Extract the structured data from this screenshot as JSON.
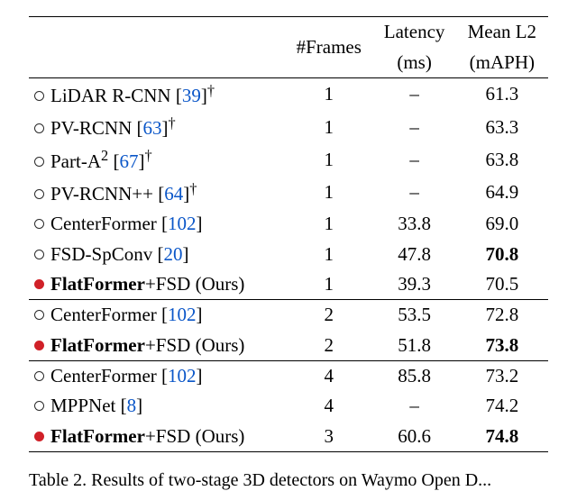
{
  "headers": {
    "method": "",
    "frames": "#Frames",
    "latency_top": "Latency",
    "latency_bot": "(ms)",
    "maph_top": "Mean L2",
    "maph_bot": "(mAPH)"
  },
  "groups": [
    {
      "rows": [
        {
          "bullet": "o",
          "name": "LiDAR R-CNN ",
          "cite": "39",
          "dagger": true,
          "sup": null,
          "bold": false,
          "frames": "1",
          "latency": "–",
          "maph": "61.3",
          "maph_bold": false
        },
        {
          "bullet": "o",
          "name": "PV-RCNN ",
          "cite": "63",
          "dagger": true,
          "sup": null,
          "bold": false,
          "frames": "1",
          "latency": "–",
          "maph": "63.3",
          "maph_bold": false
        },
        {
          "bullet": "o",
          "name": "Part-A",
          "cite": "67",
          "dagger": true,
          "sup": "2",
          "bold": false,
          "frames": "1",
          "latency": "–",
          "maph": "63.8",
          "maph_bold": false
        },
        {
          "bullet": "o",
          "name": "PV-RCNN++ ",
          "cite": "64",
          "dagger": true,
          "sup": null,
          "bold": false,
          "frames": "1",
          "latency": "–",
          "maph": "64.9",
          "maph_bold": false
        },
        {
          "bullet": "o",
          "name": "CenterFormer ",
          "cite": "102",
          "dagger": false,
          "sup": null,
          "bold": false,
          "frames": "1",
          "latency": "33.8",
          "maph": "69.0",
          "maph_bold": false
        },
        {
          "bullet": "o",
          "name": "FSD-SpConv ",
          "cite": "20",
          "dagger": false,
          "sup": null,
          "bold": false,
          "frames": "1",
          "latency": "47.8",
          "maph": "70.8",
          "maph_bold": true
        },
        {
          "bullet": "r",
          "name": "FlatFormer",
          "tail": "+FSD (Ours)",
          "cite": null,
          "dagger": false,
          "sup": null,
          "bold": true,
          "frames": "1",
          "latency": "39.3",
          "maph": "70.5",
          "maph_bold": false
        }
      ]
    },
    {
      "rows": [
        {
          "bullet": "o",
          "name": "CenterFormer ",
          "cite": "102",
          "dagger": false,
          "sup": null,
          "bold": false,
          "frames": "2",
          "latency": "53.5",
          "maph": "72.8",
          "maph_bold": false
        },
        {
          "bullet": "r",
          "name": "FlatFormer",
          "tail": "+FSD (Ours)",
          "cite": null,
          "dagger": false,
          "sup": null,
          "bold": true,
          "frames": "2",
          "latency": "51.8",
          "maph": "73.8",
          "maph_bold": true
        }
      ]
    },
    {
      "rows": [
        {
          "bullet": "o",
          "name": "CenterFormer ",
          "cite": "102",
          "dagger": false,
          "sup": null,
          "bold": false,
          "frames": "4",
          "latency": "85.8",
          "maph": "73.2",
          "maph_bold": false
        },
        {
          "bullet": "o",
          "name": "MPPNet ",
          "cite": "8",
          "dagger": false,
          "sup": null,
          "bold": false,
          "frames": "4",
          "latency": "–",
          "maph": "74.2",
          "maph_bold": false
        },
        {
          "bullet": "r",
          "name": "FlatFormer",
          "tail": "+FSD (Ours)",
          "cite": null,
          "dagger": false,
          "sup": null,
          "bold": true,
          "frames": "3",
          "latency": "60.6",
          "maph": "74.8",
          "maph_bold": true
        }
      ]
    }
  ],
  "caption": "Table 2. Results of two-stage 3D detectors on Waymo Open D..."
}
